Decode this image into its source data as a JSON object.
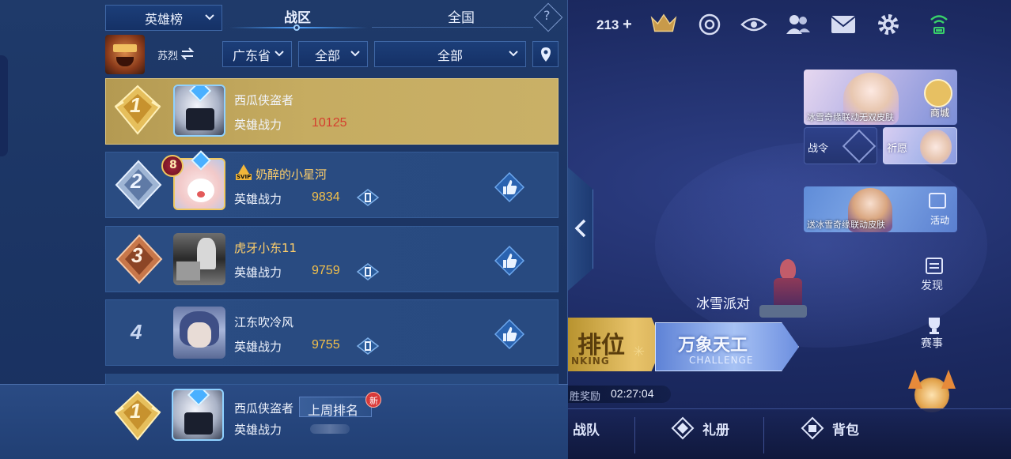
{
  "header": {
    "leaderboard_select": "英雄榜",
    "tab_region": "战区",
    "tab_national": "全国",
    "help": "?"
  },
  "profile": {
    "hero_name": "苏烈"
  },
  "filters": {
    "province": "广东省",
    "city": "全部",
    "type": "全部"
  },
  "players": [
    {
      "rank": "1",
      "name": "西瓜侠盗者",
      "label": "英雄战力",
      "power": "10125"
    },
    {
      "rank": "2",
      "name": "奶醉的小星河",
      "label": "英雄战力",
      "power": "9834",
      "level_badge": "8",
      "vip": "SVIP"
    },
    {
      "rank": "3",
      "name": "虎牙小东11",
      "label": "英雄战力",
      "power": "9759"
    },
    {
      "rank": "4",
      "name": "江东吹冷风",
      "label": "英雄战力",
      "power": "9755"
    }
  ],
  "self_row": {
    "rank": "1",
    "name": "西瓜侠盗者",
    "last_week_label": "上周排名",
    "new_badge": "新",
    "label": "英雄战力"
  },
  "background": {
    "counter": "213",
    "banner1_text": "冰雪奇缘联动无双皮肤",
    "banner1_side": "商城",
    "battle_pass": "战令",
    "wish": "祈愿",
    "banner2_text": "送冰雪奇缘联动皮肤",
    "banner2_side": "活动",
    "discover": "发现",
    "events": "赛事",
    "party": "冰雪派对",
    "rank_mode": "排位",
    "rank_mode_en": "NKING",
    "challenge_mode": "万象天工",
    "challenge_mode_en": "CHALLENGE",
    "reward_timer_label": "胜奖励",
    "reward_timer": "02:27:04",
    "team": "战队",
    "gift": "礼册",
    "bag": "背包"
  },
  "colors": {
    "gold_row": "#c6ac61",
    "power_value": "#f3c04a",
    "power_value_first": "#d4402f",
    "panel_bg": "#1f3a6a",
    "tab_active_underline": "#4fa3ff"
  }
}
